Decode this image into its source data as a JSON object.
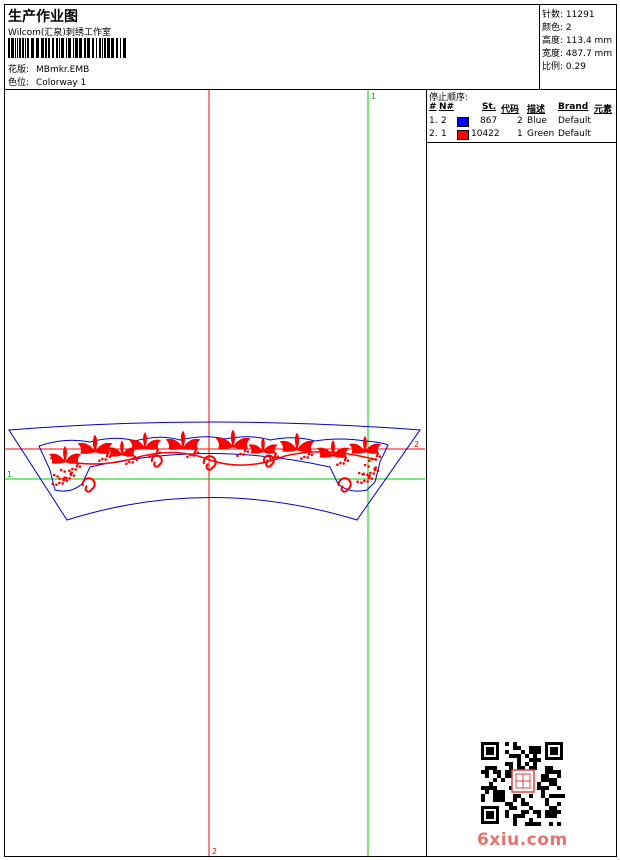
{
  "header": {
    "title": "生产作业图",
    "company": "Wilcom(汇泉)刺绣工作室",
    "design_label": "花版:",
    "design_value": "MBmkr.EMB",
    "colorway_label": "色位:",
    "colorway_value": "Colorway 1"
  },
  "info": {
    "stitches_label": "针数:",
    "stitches_value": "11291",
    "colors_label": "颜色:",
    "colors_value": "2",
    "height_label": "高度:",
    "height_value": "113.4 mm",
    "width_label": "宽度:",
    "width_value": "487.7 mm",
    "scale_label": "比例:",
    "scale_value": "0.29"
  },
  "legend": {
    "title": "停止顺序:",
    "columns": [
      "#",
      "N#",
      "St.",
      "代码",
      "描述",
      "Brand",
      "元素"
    ],
    "rows": [
      {
        "index": "1.",
        "needle": "2",
        "swatch_color": "#0000ff",
        "stitches": "867",
        "code": "2",
        "desc": "Blue",
        "brand": "Default"
      },
      {
        "index": "2.",
        "needle": "1",
        "swatch_color": "#ff0000",
        "stitches": "10422",
        "code": "1",
        "desc": "Green",
        "brand": "Default"
      }
    ]
  },
  "guides": {
    "v_green_label": "1",
    "h_green_label": "1",
    "h_red_label": "2",
    "v_red_label": "2"
  },
  "colors": {
    "red": "#ff0000",
    "green": "#00cc00",
    "blue": "#0000cc"
  },
  "watermark": "6xiu.com"
}
